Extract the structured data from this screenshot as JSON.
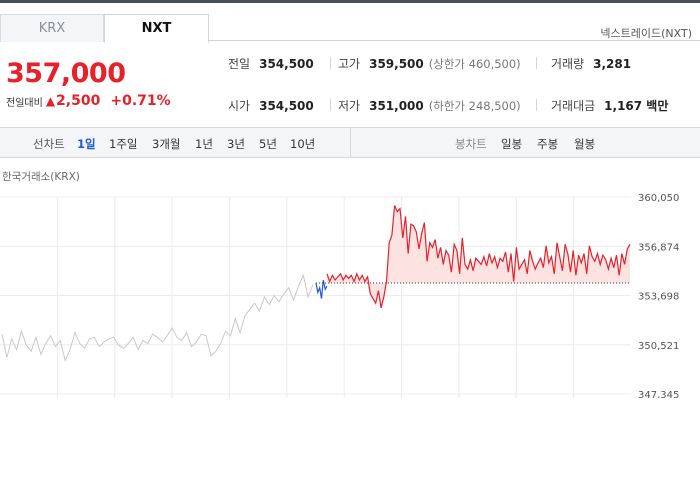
{
  "tabs": [
    {
      "label": "KRX",
      "active": false
    },
    {
      "label": "NXT",
      "active": true
    }
  ],
  "market_name": "넥스트레이드(NXT)",
  "quote": {
    "price": "357,000",
    "change_label": "전일대비",
    "change_arrow": "▲",
    "change_amount": "2,500",
    "change_percent": "+0.71%"
  },
  "metrics": {
    "prev_close": {
      "label": "전일",
      "value": "354,500"
    },
    "high": {
      "label": "고가",
      "value": "359,500",
      "limit": "(상한가 460,500)"
    },
    "volume": {
      "label": "거래량",
      "value": "3,281"
    },
    "open": {
      "label": "시가",
      "value": "354,500"
    },
    "low": {
      "label": "저가",
      "value": "351,000",
      "limit": "(하한가 248,500)"
    },
    "amount": {
      "label": "거래대금",
      "value": "1,167 백만"
    }
  },
  "controls": {
    "line_title": "선차트",
    "line_periods": [
      "1일",
      "1주일",
      "3개월",
      "1년",
      "3년",
      "5년",
      "10년"
    ],
    "active_period": "1일",
    "candle_title": "봉차트",
    "candle_periods": [
      "일봉",
      "주봉",
      "월봉"
    ]
  },
  "chart_source": "한국거래소(KRX)",
  "colors": {
    "up": "#e8202a",
    "down": "#1f5ad6",
    "inactive": "#c8c9cc",
    "up_fill": "#fde2e2"
  },
  "chart_data": {
    "type": "line",
    "title": "",
    "ylabel": "",
    "y_ticks": [
      "360,050",
      "356,874",
      "353,698",
      "350,521",
      "347,345"
    ],
    "ylim": [
      347345,
      360050
    ],
    "reference_price": 354500,
    "grid": true,
    "series": [
      {
        "role": "krx-gray",
        "values": [
          351200,
          349700,
          350900,
          350200,
          351400,
          350500,
          350100,
          351000,
          349900,
          350600,
          351100,
          350400,
          350800,
          349500,
          350200,
          351300,
          350600,
          350300,
          350900,
          351000,
          350400,
          350700,
          350900,
          351000,
          350500,
          350300,
          350600,
          351000,
          350200,
          350800,
          350600,
          351200,
          351000,
          350700,
          351100,
          351600,
          351000,
          350800,
          351300,
          350400,
          350700,
          351200,
          351100,
          349800,
          350100,
          350600,
          351400,
          351100,
          352200,
          351300,
          352400,
          352800,
          353200,
          352700,
          353600,
          353100,
          353700,
          353300,
          353800,
          354200,
          353400,
          354300,
          355000,
          353600,
          354400
        ]
      },
      {
        "role": "nxt-below-reference",
        "values": [
          354500,
          353900,
          354200,
          353500,
          354700,
          354100,
          354300
        ]
      },
      {
        "role": "nxt-above-reference",
        "values": [
          355100,
          354600,
          355000,
          354700,
          354900,
          355100,
          354700,
          355000,
          354800,
          355000,
          354600,
          355100,
          354700,
          355000,
          354600,
          354900,
          353800,
          353500,
          353200,
          354000,
          352900,
          353600,
          354600,
          357100,
          357600,
          359500,
          359100,
          359300,
          357400,
          358800,
          356400,
          358300,
          358200,
          357800,
          356700,
          357700,
          358400,
          355900,
          357100,
          356800,
          357300,
          356100,
          356800,
          355700,
          356600,
          356300,
          355200,
          357000,
          356600,
          355100,
          357400,
          355700,
          355400,
          356000,
          355300,
          356100,
          355900,
          355700,
          356200,
          355600,
          356400,
          355800,
          356200,
          355500,
          356100,
          355900,
          356500,
          355200,
          356400,
          354600,
          356800,
          355400,
          355700,
          356000,
          355100,
          356600,
          355900,
          355400,
          355800,
          356100,
          355500,
          356900,
          355800,
          356200,
          355100,
          357100,
          356200,
          355300,
          357000,
          356400,
          355200,
          356600,
          355000,
          356300,
          355800,
          356400,
          355100,
          356900,
          356200,
          355900,
          356400,
          355700,
          356300,
          356000,
          355400,
          356100,
          355500,
          356300,
          355000,
          356400,
          355700,
          356700,
          357000
        ]
      }
    ]
  }
}
